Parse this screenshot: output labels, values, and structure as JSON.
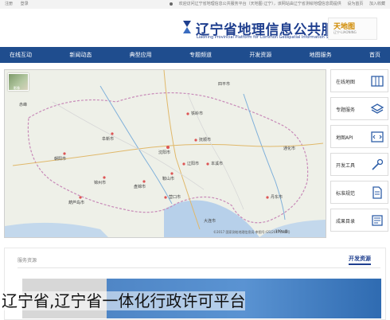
{
  "topbar": {
    "left_items": [
      "注册",
      "登录"
    ],
    "right_text": "欢迎访问辽宁省地理信息公共服务平台（天地图·辽宁），该网站由辽宁省测绘地理信息局提供",
    "right_items": [
      "设为首页",
      "加入收藏"
    ]
  },
  "header": {
    "title": "辽宁省地理信息公共服务平台",
    "subtitle": "Liaoning Provincial Platform for Common Geospatial Information Services",
    "partner_brand": "天地图",
    "partner_sub": "辽宁·LIAONING"
  },
  "nav": {
    "items": [
      "首页",
      "地图服务",
      "开发资源",
      "专题频道",
      "典型应用",
      "新闻动态",
      "在线互动"
    ]
  },
  "map": {
    "thumb_label": "影像",
    "labels": [
      {
        "id": "shenyang",
        "text": "沈阳市"
      },
      {
        "id": "fushun",
        "text": "抚顺市"
      },
      {
        "id": "tieling",
        "text": "铁岭市"
      },
      {
        "id": "anshan",
        "text": "鞍山市"
      },
      {
        "id": "liaoyang",
        "text": "辽阳市"
      },
      {
        "id": "benxi",
        "text": "本溪市"
      },
      {
        "id": "dandong",
        "text": "丹东市"
      },
      {
        "id": "yingkou",
        "text": "营口市"
      },
      {
        "id": "panjin",
        "text": "盘锦市"
      },
      {
        "id": "jinzhou",
        "text": "锦州市"
      },
      {
        "id": "huludao",
        "text": "葫芦岛市"
      },
      {
        "id": "chaoyang",
        "text": "朝阳市"
      },
      {
        "id": "fuxin",
        "text": "阜新市"
      },
      {
        "id": "dalian",
        "text": "大连市"
      },
      {
        "id": "chifeng",
        "text": "赤峰"
      },
      {
        "id": "siping",
        "text": "四平市"
      },
      {
        "id": "tonghua",
        "text": "通化市"
      }
    ],
    "copyright": "©2017 国家测绘地理信息局 审图号:GS(2017)508号",
    "scale": "100公里"
  },
  "tools": [
    {
      "label": "在线地图",
      "icon": "map-icon"
    },
    {
      "label": "专题服务",
      "icon": "layers-icon"
    },
    {
      "label": "地图API",
      "icon": "api-code-icon"
    },
    {
      "label": "开发工具",
      "icon": "tools-icon"
    },
    {
      "label": "标准规范",
      "icon": "document-icon"
    },
    {
      "label": "成果目录",
      "icon": "catalog-icon"
    }
  ],
  "lower": {
    "section_title": "服务资源",
    "open_resources": "开发资源"
  },
  "caption": "辽宁省,辽宁省一体化行政许可平台"
}
